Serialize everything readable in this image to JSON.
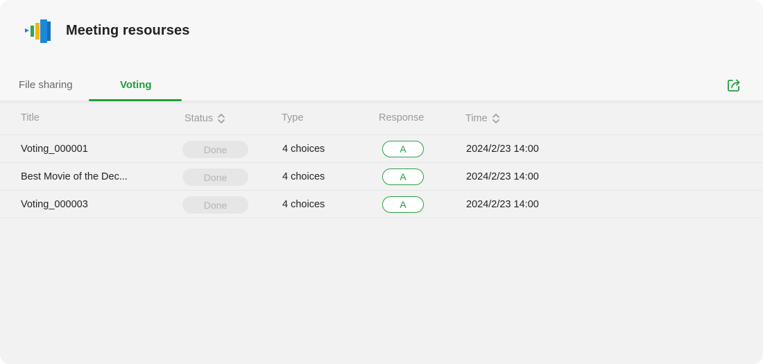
{
  "app": {
    "title": "Meeting resourses"
  },
  "tabs": [
    {
      "label": "File sharing",
      "active": false
    },
    {
      "label": "Voting",
      "active": true
    }
  ],
  "table": {
    "columns": {
      "title": "Title",
      "status": "Status",
      "type": "Type",
      "response": "Response",
      "time": "Time"
    },
    "rows": [
      {
        "title": "Voting_000001",
        "status": "Done",
        "type": "4 choices",
        "response": "A",
        "time": "2024/2/23 14:00"
      },
      {
        "title": "Best Movie of the Dec...",
        "status": "Done",
        "type": "4 choices",
        "response": "A",
        "time": "2024/2/23 14:00"
      },
      {
        "title": "Voting_000003",
        "status": "Done",
        "type": "4 choices",
        "response": "A",
        "time": "2024/2/23 14:00"
      }
    ]
  },
  "icons": {
    "logo": "meeting-logo-icon",
    "export": "export-share-icon",
    "sort": "sort-updown-icon"
  },
  "colors": {
    "accent": "#21a03c",
    "status_bg": "#e6e6e6",
    "status_text": "#b4b4b4"
  }
}
